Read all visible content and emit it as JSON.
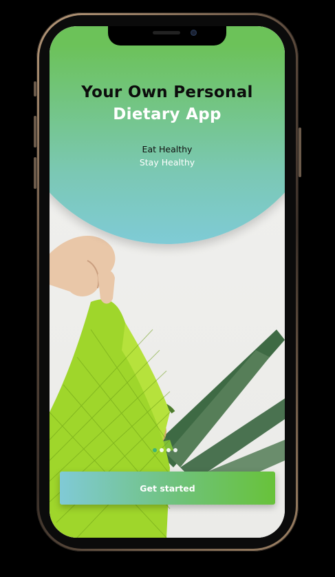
{
  "hero": {
    "title_line1": "Your Own Personal",
    "title_line2": "Dietary App",
    "subtitle_line1": "Eat Healthy",
    "subtitle_line2": "Stay Healthy"
  },
  "pager": {
    "count": 4,
    "active_index": 0
  },
  "cta": {
    "label": "Get started"
  },
  "colors": {
    "hero_green": "#6cc259",
    "hero_teal": "#7fcbd6",
    "button_start": "#80cad6",
    "button_end": "#68c23a",
    "active_dot": "#35b37a"
  }
}
